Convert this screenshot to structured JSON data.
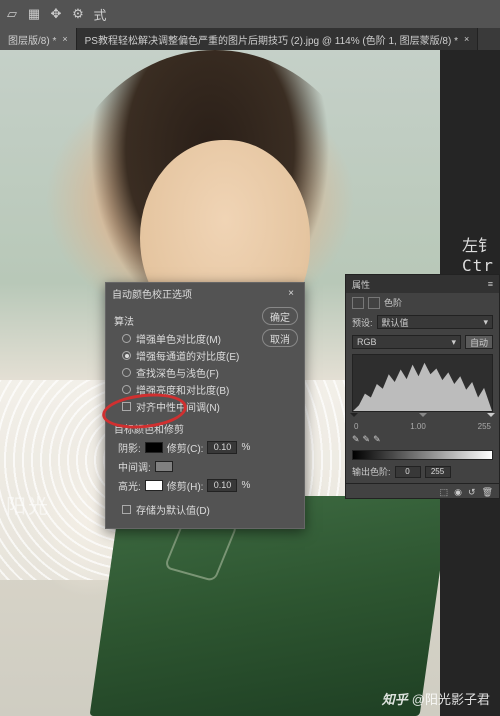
{
  "toolbar": {
    "mode_label": "式"
  },
  "tabs": [
    {
      "label": "图层版/8) *"
    },
    {
      "label": "PS教程轻松解决调整偏色严重的图片后期技巧 (2).jpg @ 114% (色阶 1, 图层蒙版/8) *"
    }
  ],
  "side": {
    "line1": "左钅",
    "line2": "Ctr"
  },
  "dialog": {
    "title": "自动颜色校正选项",
    "algorithm_label": "算法",
    "opts": {
      "mono": "增强单色对比度(M)",
      "per": "增强每通道的对比度(E)",
      "dark": "查找深色与浅色(F)",
      "bright": "增强亮度和对比度(B)",
      "snap": "对齐中性中间调(N)"
    },
    "target_label": "目标颜色和修剪",
    "rows": {
      "shadow": {
        "label": "阴影:",
        "clip": "修剪(C):",
        "val": "0.10"
      },
      "mid": {
        "label": "中间调:"
      },
      "high": {
        "label": "高光:",
        "clip": "修剪(H):",
        "val": "0.10"
      }
    },
    "pct": "%",
    "save_default": "存储为默认值(D)",
    "ok": "确定",
    "cancel": "取消"
  },
  "panel": {
    "tab": "属性",
    "type_label": "色阶",
    "preset_label": "预设:",
    "preset_value": "默认值",
    "channel": "RGB",
    "auto": "自动",
    "in_vals": {
      "a": "0",
      "b": "1.00",
      "c": "255"
    },
    "out_label": "输出色阶:",
    "out_vals": {
      "a": "0",
      "b": "255"
    }
  },
  "watermark_left": "阳光",
  "watermark": {
    "brand": "知乎",
    "user": "@阳光影子君"
  }
}
